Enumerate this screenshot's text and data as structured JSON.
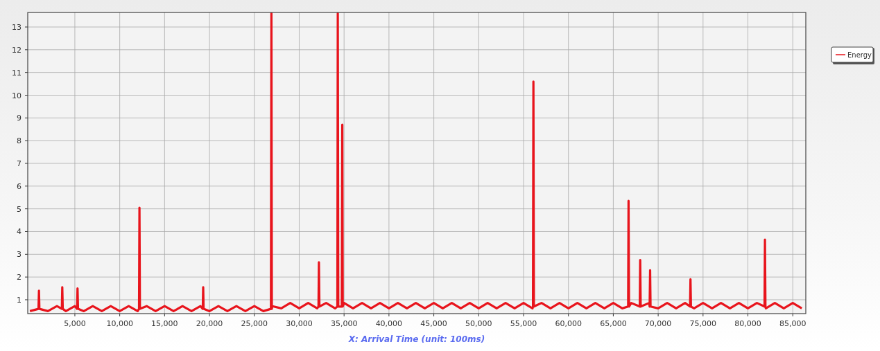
{
  "chart": {
    "chart_data": {
      "type": "line",
      "grid": true,
      "xlabel": "X: Arrival Time (unit: 100ms)",
      "xlim": [
        -250,
        86450
      ],
      "ylim": [
        0.39,
        13.64
      ],
      "xticks": [
        {
          "value": 5000,
          "label": "5,000"
        },
        {
          "value": 10000,
          "label": "10,000"
        },
        {
          "value": 15000,
          "label": "15,000"
        },
        {
          "value": 20000,
          "label": "20,000"
        },
        {
          "value": 25000,
          "label": "25,000"
        },
        {
          "value": 30000,
          "label": "30,000"
        },
        {
          "value": 35000,
          "label": "35,000"
        },
        {
          "value": 40000,
          "label": "40,000"
        },
        {
          "value": 45000,
          "label": "45,000"
        },
        {
          "value": 50000,
          "label": "50,000"
        },
        {
          "value": 55000,
          "label": "55,000"
        },
        {
          "value": 60000,
          "label": "60,000"
        },
        {
          "value": 65000,
          "label": "65,000"
        },
        {
          "value": 70000,
          "label": "70,000"
        },
        {
          "value": 75000,
          "label": "75,000"
        },
        {
          "value": 80000,
          "label": "80,000"
        },
        {
          "value": 85000,
          "label": "85,000"
        }
      ],
      "yticks": [
        1,
        2,
        3,
        4,
        5,
        6,
        7,
        8,
        9,
        10,
        11,
        12,
        13
      ],
      "x": [
        0,
        950,
        1000,
        1050,
        2000,
        3000,
        3550,
        3600,
        3650,
        4000,
        5000,
        5250,
        5300,
        5350,
        6000,
        7000,
        8000,
        9000,
        10000,
        11000,
        12000,
        12150,
        12200,
        12250,
        13000,
        14000,
        15000,
        16000,
        17000,
        18000,
        19000,
        19250,
        19300,
        19350,
        20000,
        21000,
        22000,
        23000,
        24000,
        25000,
        26000,
        26850,
        26900,
        26950,
        27000,
        28000,
        29000,
        30000,
        31000,
        32000,
        32150,
        32200,
        32250,
        33000,
        34000,
        34250,
        34300,
        34350,
        34750,
        34800,
        34850,
        35000,
        36000,
        37000,
        38000,
        39000,
        40000,
        41000,
        42000,
        43000,
        44000,
        45000,
        46000,
        47000,
        48000,
        49000,
        50000,
        51000,
        52000,
        53000,
        54000,
        55000,
        56000,
        56050,
        56100,
        56150,
        57000,
        58000,
        59000,
        60000,
        61000,
        62000,
        63000,
        64000,
        65000,
        66000,
        66650,
        66700,
        66750,
        67000,
        67950,
        68000,
        68050,
        69000,
        69050,
        69100,
        69150,
        70000,
        71000,
        72000,
        73000,
        73550,
        73600,
        73650,
        74000,
        75000,
        76000,
        77000,
        78000,
        79000,
        80000,
        81000,
        81850,
        81900,
        81950,
        82000,
        83000,
        84000,
        85000,
        86000
      ],
      "series": [
        {
          "name": "Energy",
          "color": "#e8141c",
          "values": [
            0.5,
            0.6,
            1.4,
            0.6,
            0.5,
            0.72,
            0.6,
            1.55,
            0.6,
            0.5,
            0.72,
            0.6,
            1.5,
            0.6,
            0.5,
            0.72,
            0.5,
            0.72,
            0.5,
            0.72,
            0.5,
            0.6,
            5.05,
            0.6,
            0.72,
            0.5,
            0.72,
            0.5,
            0.72,
            0.5,
            0.72,
            0.6,
            1.55,
            0.6,
            0.5,
            0.72,
            0.5,
            0.72,
            0.5,
            0.72,
            0.5,
            0.6,
            13.6,
            0.6,
            0.72,
            0.62,
            0.86,
            0.62,
            0.86,
            0.62,
            0.7,
            2.65,
            0.7,
            0.86,
            0.62,
            0.7,
            13.6,
            0.7,
            0.7,
            8.7,
            0.7,
            0.86,
            0.62,
            0.86,
            0.62,
            0.86,
            0.62,
            0.86,
            0.62,
            0.86,
            0.62,
            0.86,
            0.62,
            0.86,
            0.62,
            0.86,
            0.62,
            0.86,
            0.62,
            0.86,
            0.62,
            0.86,
            0.62,
            0.7,
            10.6,
            0.7,
            0.86,
            0.62,
            0.86,
            0.62,
            0.86,
            0.62,
            0.86,
            0.62,
            0.86,
            0.62,
            0.7,
            5.35,
            0.7,
            0.86,
            0.7,
            2.75,
            0.7,
            0.86,
            0.7,
            2.3,
            0.7,
            0.62,
            0.86,
            0.62,
            0.86,
            0.7,
            1.9,
            0.7,
            0.62,
            0.86,
            0.62,
            0.86,
            0.62,
            0.86,
            0.62,
            0.86,
            0.7,
            3.65,
            0.7,
            0.62,
            0.86,
            0.62,
            0.86,
            0.62
          ]
        }
      ]
    }
  }
}
